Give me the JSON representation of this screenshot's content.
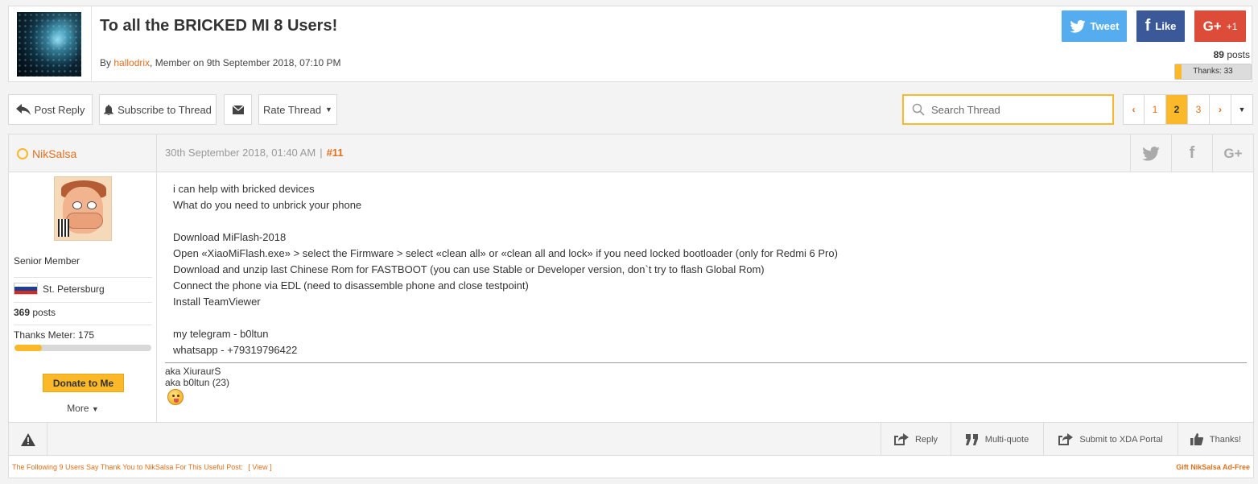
{
  "thread": {
    "title": "To all the BRICKED MI 8 Users!",
    "by_prefix": "By ",
    "author": "hallodrix",
    "by_suffix": ", Member on 9th September 2018, 07:10 PM",
    "posts_count": "89",
    "posts_label": " posts",
    "thanks_label": "Thanks: 33",
    "thanks_fill_fraction": 0.08
  },
  "social": {
    "tweet": "Tweet",
    "like": "Like",
    "gplus_count": "+1",
    "colors": {
      "twitter": "#55acee",
      "facebook": "#3b5998",
      "gplus": "#dd4b39"
    }
  },
  "toolbar": {
    "post_reply": "Post Reply",
    "subscribe": "Subscribe to Thread",
    "rate": "Rate Thread",
    "search_placeholder": "Search Thread"
  },
  "pagination": {
    "pages": [
      "1",
      "2",
      "3"
    ],
    "current": "2"
  },
  "post": {
    "username": "NikSalsa",
    "date": "30th September 2018, 01:40 AM",
    "separator": "|",
    "number": "#11",
    "rank": "Senior Member",
    "location": "St. Petersburg",
    "posts_count": "369",
    "posts_label": " posts",
    "thanks_meter": "Thanks Meter: 175",
    "thanks_meter_fraction": 0.2,
    "donate": "Donate to Me",
    "more": "More",
    "body_lines": [
      "i can help with bricked devices",
      "What do you need to unbrick your phone",
      "",
      "Download MiFlash-2018",
      "Open «XiaoMiFlash.exe» > select the Firmware > select «clean all» or «clean all and lock» if you need locked bootloader (only for Redmi 6 Pro)",
      "Download and unzip last Chinese Rom for FASTBOOT (you can use Stable or Developer version, don`t try to flash Global Rom)",
      "Connect the phone via EDL (need to disassemble phone and close testpoint)",
      "Install TeamViewer",
      "",
      "my telegram - b0ltun",
      "whatsapp - +79319796422"
    ],
    "signature": [
      "aka XiuraurS",
      "aka b0ltun (23)"
    ]
  },
  "post_actions": {
    "reply": "Reply",
    "multiquote": "Multi-quote",
    "submit": "Submit to XDA Portal",
    "thanks": "Thanks!"
  },
  "footer": {
    "thanks_text": "The Following 9 Users Say Thank You to NikSalsa For This Useful Post:",
    "view": "[ View ]",
    "gift": "Gift NikSalsa Ad-Free"
  },
  "colors": {
    "accent": "#fbb829",
    "link": "#e1701e"
  }
}
